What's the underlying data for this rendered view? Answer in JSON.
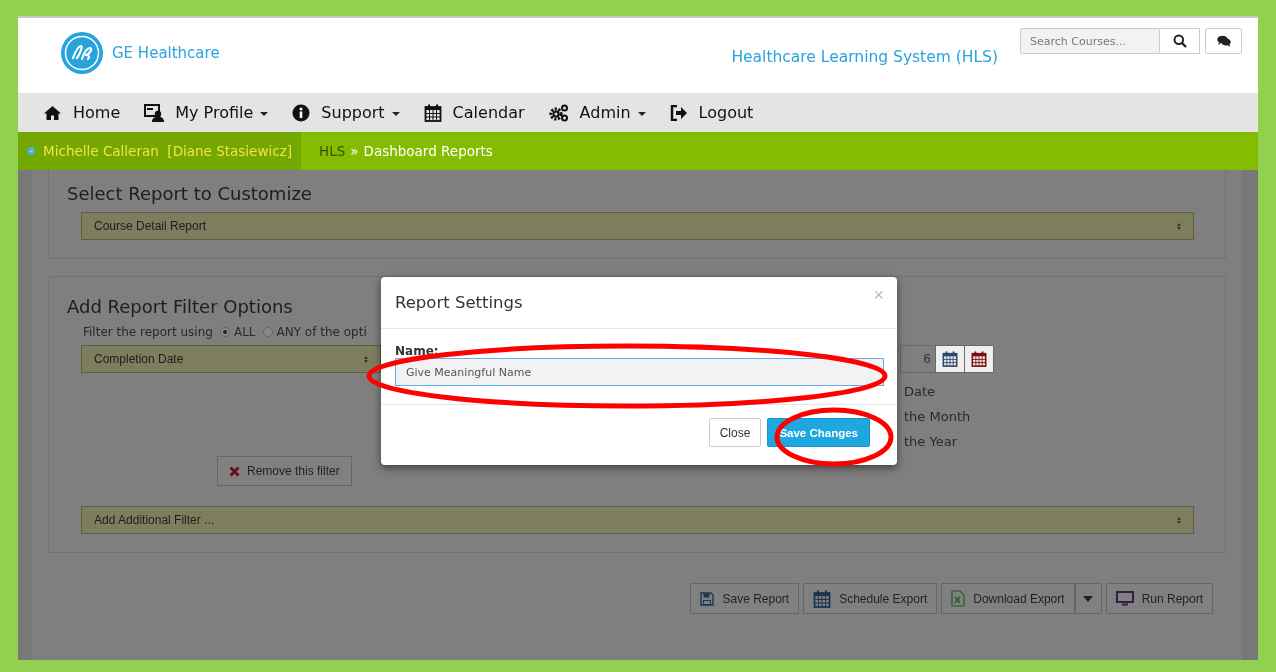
{
  "header": {
    "logo_text": "GE Healthcare",
    "system_title": "Healthcare Learning System (HLS)",
    "search": {
      "placeholder": "Search Courses..."
    }
  },
  "nav": [
    {
      "label": "Home",
      "kind": "home",
      "dropdown": false
    },
    {
      "label": "My Profile",
      "kind": "profile",
      "dropdown": true
    },
    {
      "label": "Support",
      "kind": "info",
      "dropdown": true
    },
    {
      "label": "Calendar",
      "kind": "calendar",
      "dropdown": false
    },
    {
      "label": "Admin",
      "kind": "gears",
      "dropdown": true
    },
    {
      "label": "Logout",
      "kind": "logout",
      "dropdown": false
    }
  ],
  "breadcrumb": {
    "user": "Michelle Calleran",
    "proxy": "[Diane Stasiewicz]",
    "root": "HLS",
    "separator": "»",
    "current": "Dashboard Reports"
  },
  "select_report": {
    "heading": "Select Report to Customize",
    "value": "Course Detail Report"
  },
  "filters": {
    "heading": "Add Report Filter Options",
    "filter_label": "Filter the report using",
    "modes": [
      {
        "label": "ALL",
        "selected": true
      },
      {
        "label": "ANY of the opti",
        "selected": false
      }
    ],
    "filter_field": "Completion Date",
    "date_value": "6",
    "date_options": [
      "Date",
      "the Month",
      "the Year"
    ],
    "remove_button": "Remove this filter",
    "add_filter": "Add Additional Filter ..."
  },
  "actions": [
    {
      "label": "Save Report",
      "kind": "save",
      "split": false
    },
    {
      "label": "Schedule Export",
      "kind": "calendar",
      "split": false
    },
    {
      "label": "Download Export",
      "kind": "excel",
      "split": true
    },
    {
      "label": "Run Report",
      "kind": "monitor",
      "split": false
    }
  ],
  "modal": {
    "title": "Report Settings",
    "close_symbol": "×",
    "field_label": "Name:",
    "field_value": "Give Meaningful Name",
    "buttons": [
      {
        "label": "Close",
        "primary": false
      },
      {
        "label": "Save Changes",
        "primary": true
      }
    ]
  },
  "annotations": [
    {
      "kind": "ellipse"
    },
    {
      "kind": "ellipse"
    }
  ]
}
